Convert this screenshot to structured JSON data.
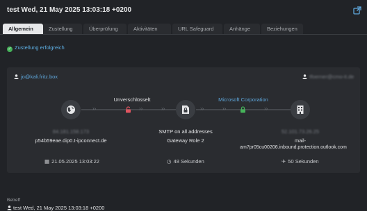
{
  "header": {
    "title": "test Wed, 21 May 2025 13:03:18 +0200",
    "external_icon": "external-link-icon"
  },
  "tabs": [
    {
      "label": "Allgemein",
      "active": true
    },
    {
      "label": "Zustellung",
      "active": false
    },
    {
      "label": "Überprüfung",
      "active": false
    },
    {
      "label": "Aktivitäten",
      "active": false
    },
    {
      "label": "URL Safeguard",
      "active": false
    },
    {
      "label": "Anhänge",
      "active": false
    },
    {
      "label": "Beziehungen",
      "active": false
    }
  ],
  "status": {
    "text": "Zustellung erfolgreich",
    "icon": "check-circle-icon",
    "color": "#46b35a"
  },
  "flow": {
    "sender_address": "jo@kali.fritz.box",
    "recipient_address": "tfoerner@cmo-it.de",
    "hop1_label": "Unverschlüsselt",
    "hop2_label": "Microsoft Corporation",
    "source": {
      "icon": "globe-icon",
      "ip": "84.181.158.173",
      "host": "p54b59eae.dip0.t-ipconnect.de",
      "date": "21.05.2025 13:03:22"
    },
    "gateway": {
      "icon": "gateway-lock-icon",
      "line1": "SMTP on all addresses",
      "line2": "Gateway Role 2",
      "duration": "48 Sekunden"
    },
    "destination": {
      "icon": "building-icon",
      "ip": "52.101.73.26.25",
      "host_prefix": "mail-",
      "host": "am7pr05cu00206.inbound.protection.outlook.com",
      "duration": "50 Sekunden"
    }
  },
  "betreff": {
    "label": "Betreff",
    "value": "test Wed, 21 May 2025 13:03:18 +0200"
  },
  "colors": {
    "accent": "#5fa8dd",
    "unlocked": "#e05560",
    "locked": "#46b35a"
  }
}
